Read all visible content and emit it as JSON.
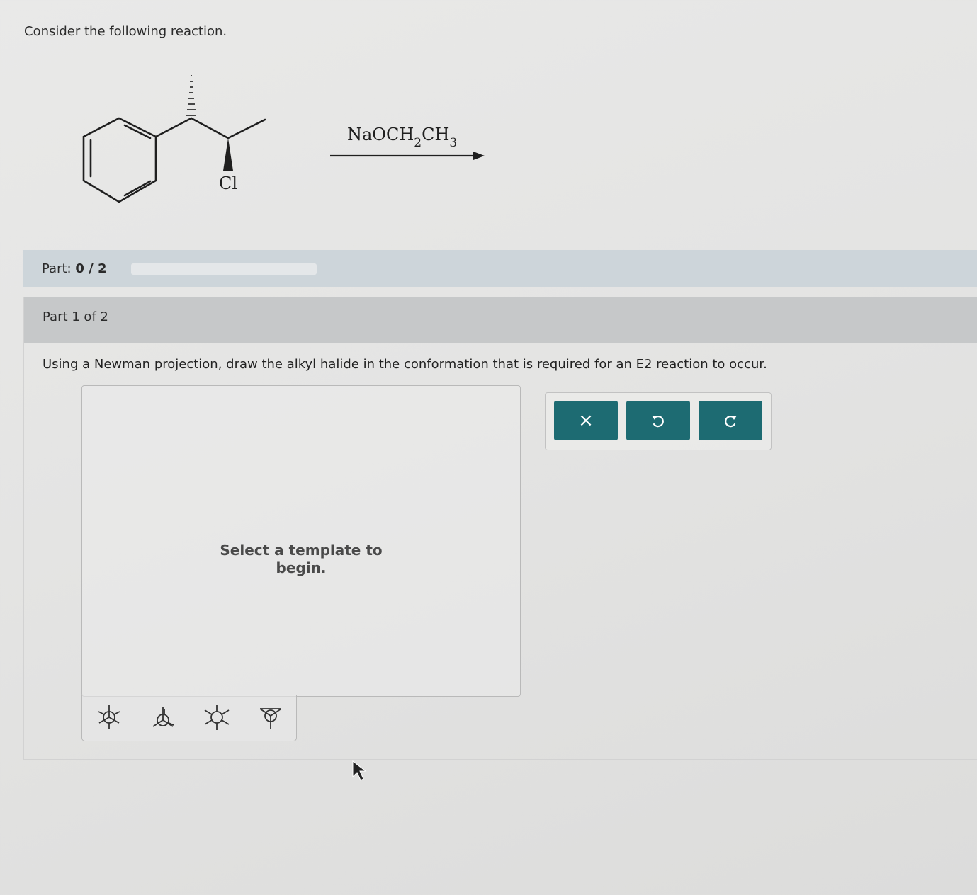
{
  "prompt": {
    "text": "Consider the following reaction."
  },
  "reaction": {
    "substituent_label": "Cl",
    "reagent": {
      "base": "NaOCH",
      "sub1": "2",
      "mid": "CH",
      "sub2": "3"
    }
  },
  "progress": {
    "label": "Part:",
    "value": "0 / 2",
    "fraction": 0
  },
  "part": {
    "title": "Part 1 of 2",
    "question": "Using a Newman projection, draw the alkyl halide in the conformation that is required for an E2 reaction to occur."
  },
  "canvas": {
    "placeholder": "Select a template to begin."
  },
  "templates": [
    {
      "icon": "newman-staggered-icon"
    },
    {
      "icon": "newman-eclipsed-icon"
    },
    {
      "icon": "newman-staggered-alt-icon"
    },
    {
      "icon": "newman-partial-icon"
    }
  ],
  "toolbar": {
    "clear_label": "×",
    "undo_icon": "undo-icon",
    "redo_icon": "redo-icon",
    "accent": "#1d6b72"
  }
}
